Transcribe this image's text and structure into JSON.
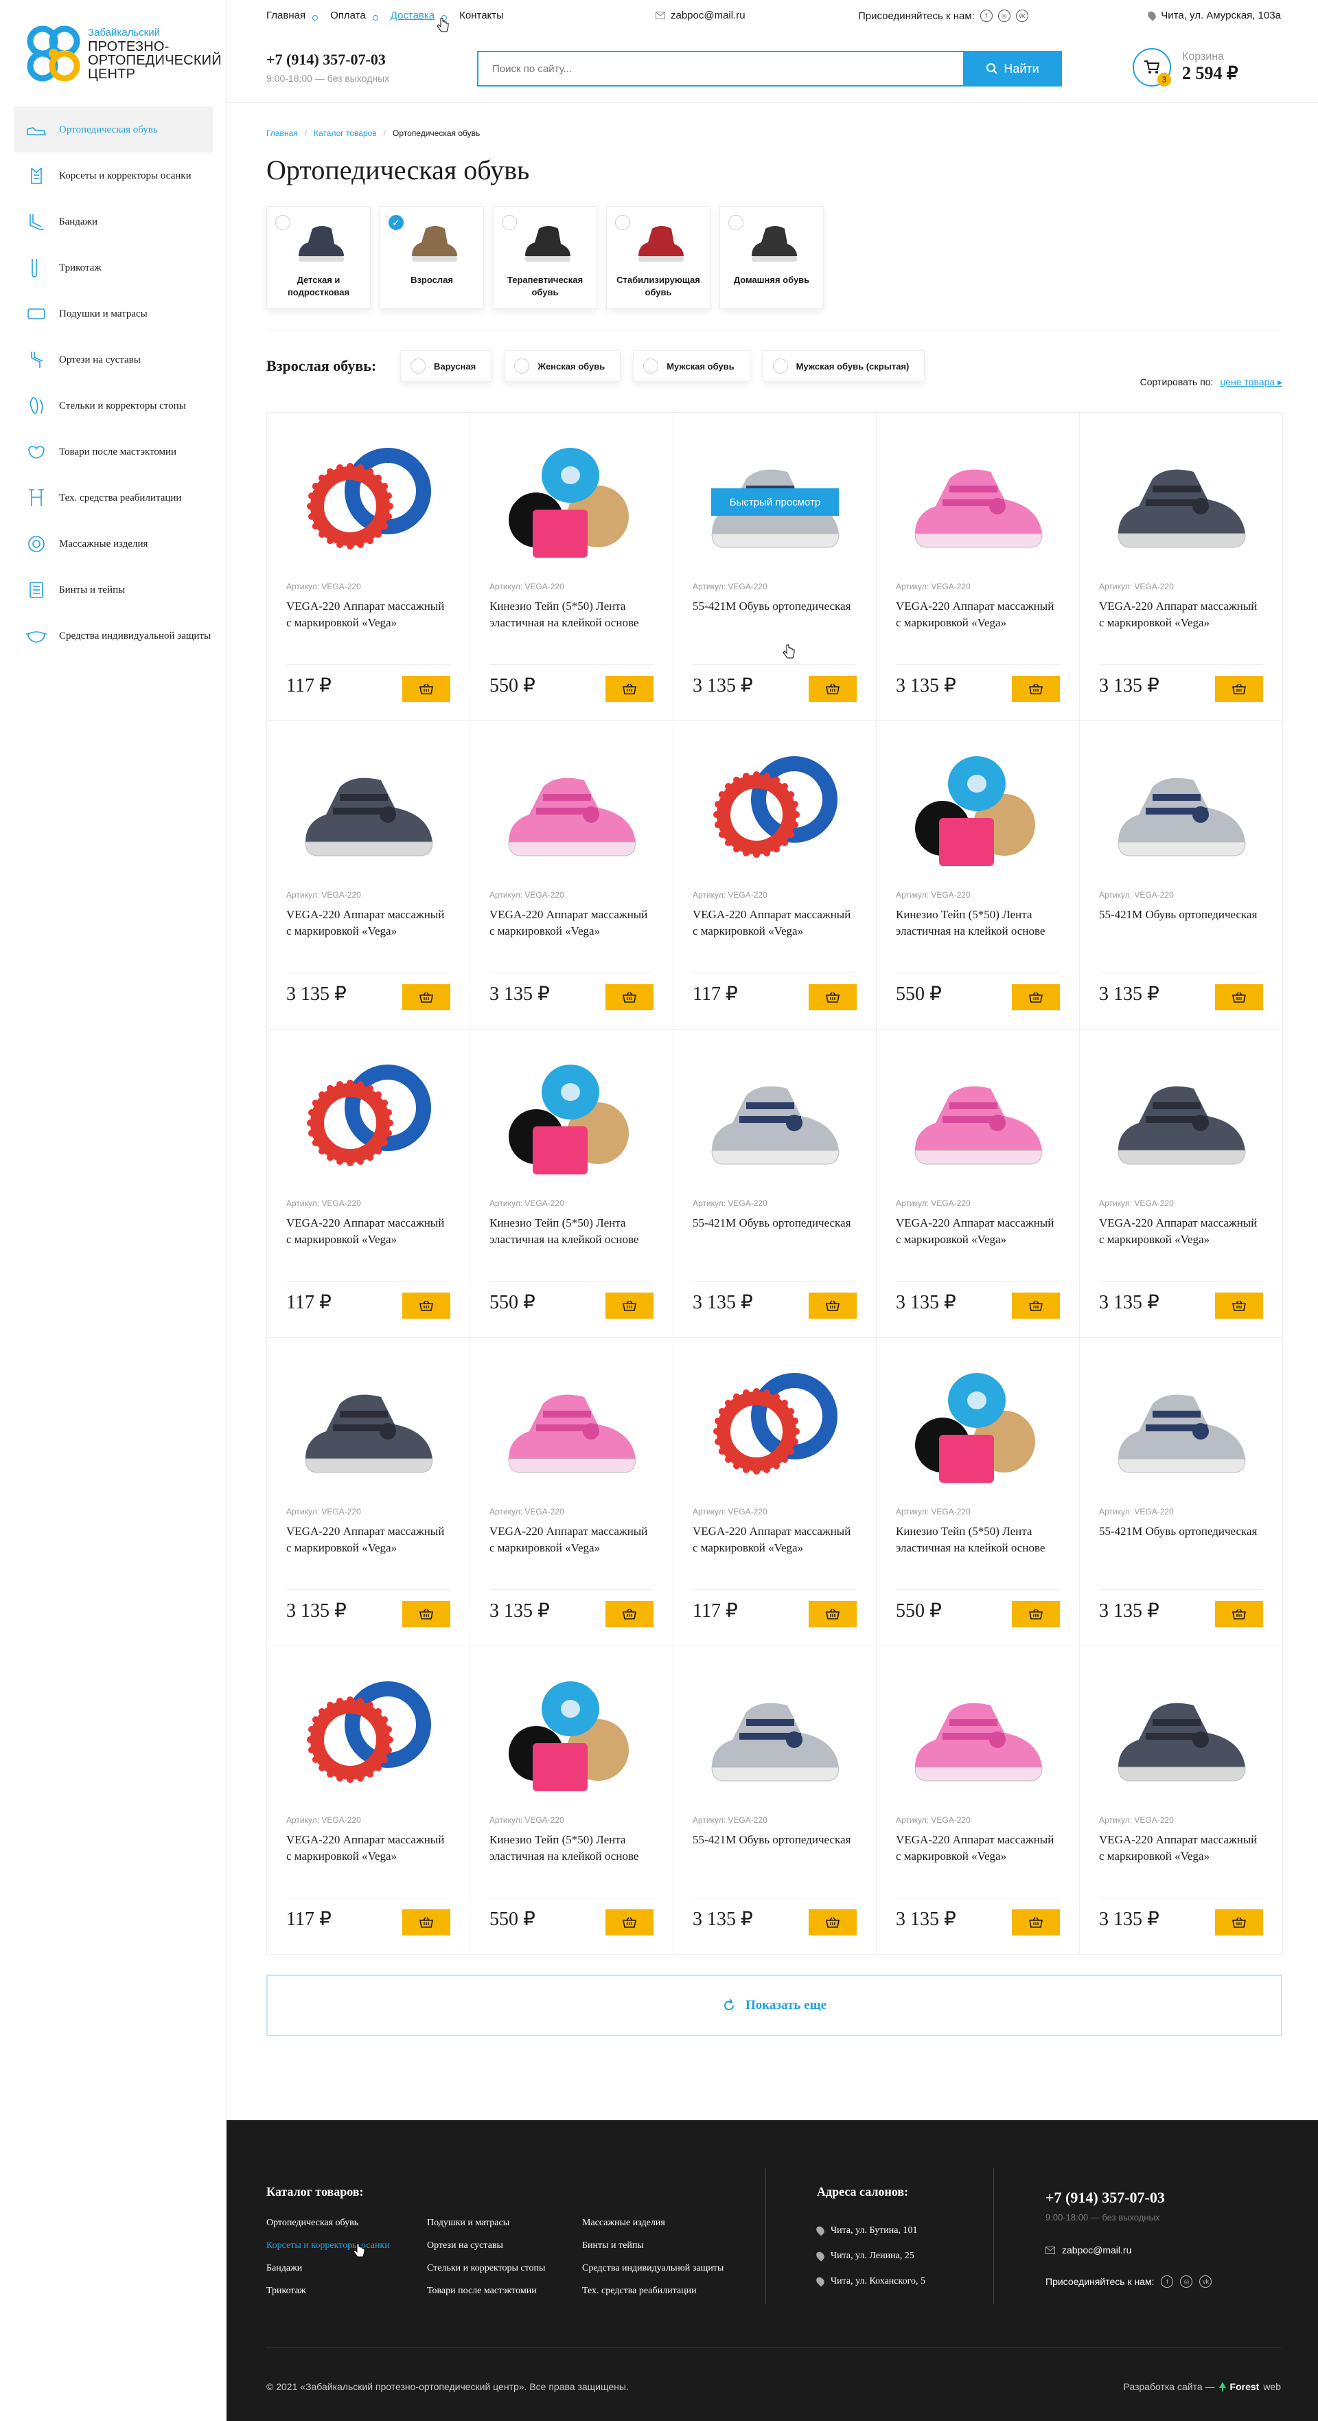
{
  "logo": {
    "line1": "Забайкальский",
    "line2": "ПРОТЕЗНО-",
    "line3": "ОРТОПЕДИЧЕСКИЙ",
    "line4": "ЦЕНТР"
  },
  "sidebar": {
    "items": [
      {
        "label": "Ортопедическая обувь",
        "icon": "shoe-icon",
        "active": true
      },
      {
        "label": "Корсеты и корректоры осанки",
        "icon": "corset-icon"
      },
      {
        "label": "Бандажи",
        "icon": "bandage-icon"
      },
      {
        "label": "Трикотаж",
        "icon": "stocking-icon"
      },
      {
        "label": "Подушки и матрасы",
        "icon": "pillow-icon"
      },
      {
        "label": "Ортези на суставы",
        "icon": "joint-icon"
      },
      {
        "label": "Стельки и корректоры стопы",
        "icon": "insole-icon"
      },
      {
        "label": "Товари после мастэктомии",
        "icon": "mastectomy-icon"
      },
      {
        "label": "Тех. средства реабилитации",
        "icon": "crutch-icon"
      },
      {
        "label": "Массажные изделия",
        "icon": "massage-icon"
      },
      {
        "label": "Бинты и тейпы",
        "icon": "tape-icon"
      },
      {
        "label": "Средства индивидуальной защиты",
        "icon": "mask-icon"
      }
    ]
  },
  "topbar": {
    "nav": [
      "Главная",
      "Оплата",
      "Доставка",
      "Контакты"
    ],
    "email": "zabpoc@mail.ru",
    "join_label": "Присоединяйтесь к нам:",
    "address": "Чита, ул. Амурская, 103а"
  },
  "header": {
    "phone": "+7 (914) 357-07-03",
    "hours": "9:00-18:00 — без выходных",
    "search_placeholder": "Поиск по сайту...",
    "search_button": "Найти",
    "cart_label": "Корзина",
    "cart_total": "2 594 ₽",
    "cart_count": "3"
  },
  "breadcrumbs": [
    "Главная",
    "Каталог товаров",
    "Ортопедическая обувь"
  ],
  "page_title": "Ортопедическая обувь",
  "categories": [
    {
      "name": "Детская и подростковая",
      "checked": false
    },
    {
      "name": "Взрослая",
      "checked": true
    },
    {
      "name": "Терапевтическая обувь",
      "checked": false
    },
    {
      "name": "Стабилизирующая обувь",
      "checked": false
    },
    {
      "name": "Домашняя обувь",
      "checked": false
    }
  ],
  "filter": {
    "label": "Взрослая обувь:",
    "options": [
      "Варусная",
      "Женская обувь",
      "Мужская обувь",
      "Мужская обувь (скрытая)"
    ]
  },
  "sort": {
    "label": "Сортировать по:",
    "value": "цене товара"
  },
  "quick_view": "Быстрый просмотр",
  "products": [
    {
      "img": "ring",
      "sku": "Артикул: VEGA-220",
      "title": "VEGA-220 Аппарат массажный с маркировкой «Vega»",
      "price": "117 ₽"
    },
    {
      "img": "tape",
      "sku": "Артикул: VEGA-220",
      "title": "Кинезио Тейп (5*50) Лента эластичная на клейкой основе",
      "price": "550 ₽"
    },
    {
      "img": "grey",
      "sku": "Артикул: VEGA-220",
      "title": "55-421M Обувь ортопедическая",
      "price": "3 135 ₽"
    },
    {
      "img": "pink",
      "sku": "Артикул: VEGA-220",
      "title": "VEGA-220 Аппарат массажный с маркировкой «Vega»",
      "price": "3 135 ₽"
    },
    {
      "img": "dark",
      "sku": "Артикул: VEGA-220",
      "title": "VEGA-220 Аппарат массажный с маркировкой «Vega»",
      "price": "3 135 ₽"
    },
    {
      "img": "dark",
      "sku": "Артикул: VEGA-220",
      "title": "VEGA-220 Аппарат массажный с маркировкой «Vega»",
      "price": "3 135 ₽"
    },
    {
      "img": "pink",
      "sku": "Артикул: VEGA-220",
      "title": "VEGA-220 Аппарат массажный с маркировкой «Vega»",
      "price": "3 135 ₽"
    },
    {
      "img": "ring",
      "sku": "Артикул: VEGA-220",
      "title": "VEGA-220 Аппарат массажный с маркировкой «Vega»",
      "price": "117 ₽"
    },
    {
      "img": "tape",
      "sku": "Артикул: VEGA-220",
      "title": "Кинезио Тейп (5*50) Лента эластичная на клейкой основе",
      "price": "550 ₽"
    },
    {
      "img": "grey",
      "sku": "Артикул: VEGA-220",
      "title": "55-421M Обувь ортопедическая",
      "price": "3 135 ₽"
    },
    {
      "img": "ring",
      "sku": "Артикул: VEGA-220",
      "title": "VEGA-220 Аппарат массажный с маркировкой «Vega»",
      "price": "117 ₽"
    },
    {
      "img": "tape",
      "sku": "Артикул: VEGA-220",
      "title": "Кинезио Тейп (5*50) Лента эластичная на клейкой основе",
      "price": "550 ₽"
    },
    {
      "img": "grey",
      "sku": "Артикул: VEGA-220",
      "title": "55-421M Обувь ортопедическая",
      "price": "3 135 ₽"
    },
    {
      "img": "pink",
      "sku": "Артикул: VEGA-220",
      "title": "VEGA-220 Аппарат массажный с маркировкой «Vega»",
      "price": "3 135 ₽"
    },
    {
      "img": "dark",
      "sku": "Артикул: VEGA-220",
      "title": "VEGA-220 Аппарат массажный с маркировкой «Vega»",
      "price": "3 135 ₽"
    },
    {
      "img": "dark",
      "sku": "Артикул: VEGA-220",
      "title": "VEGA-220 Аппарат массажный с маркировкой «Vega»",
      "price": "3 135 ₽"
    },
    {
      "img": "pink",
      "sku": "Артикул: VEGA-220",
      "title": "VEGA-220 Аппарат массажный с маркировкой «Vega»",
      "price": "3 135 ₽"
    },
    {
      "img": "ring",
      "sku": "Артикул: VEGA-220",
      "title": "VEGA-220 Аппарат массажный с маркировкой «Vega»",
      "price": "117 ₽"
    },
    {
      "img": "tape",
      "sku": "Артикул: VEGA-220",
      "title": "Кинезио Тейп (5*50) Лента эластичная на клейкой основе",
      "price": "550 ₽"
    },
    {
      "img": "grey",
      "sku": "Артикул: VEGA-220",
      "title": "55-421M Обувь ортопедическая",
      "price": "3 135 ₽"
    },
    {
      "img": "ring",
      "sku": "Артикул: VEGA-220",
      "title": "VEGA-220 Аппарат массажный с маркировкой «Vega»",
      "price": "117 ₽"
    },
    {
      "img": "tape",
      "sku": "Артикул: VEGA-220",
      "title": "Кинезио Тейп (5*50) Лента эластичная на клейкой основе",
      "price": "550 ₽"
    },
    {
      "img": "grey",
      "sku": "Артикул: VEGA-220",
      "title": "55-421M Обувь ортопедическая",
      "price": "3 135 ₽"
    },
    {
      "img": "pink",
      "sku": "Артикул: VEGA-220",
      "title": "VEGA-220 Аппарат массажный с маркировкой «Vega»",
      "price": "3 135 ₽"
    },
    {
      "img": "dark",
      "sku": "Артикул: VEGA-220",
      "title": "VEGA-220 Аппарат массажный с маркировкой «Vega»",
      "price": "3 135 ₽"
    }
  ],
  "show_more": "Показать еще",
  "footer": {
    "catalog_title": "Каталог товаров:",
    "col1": [
      "Ортопедическая обувь",
      "Корсеты и корректоры осанки",
      "Бандажи",
      "Трикотаж"
    ],
    "col2": [
      "Подушки и матрасы",
      "Ортези на суставы",
      "Стельки и корректоры стопы",
      "Товари после мастэктомии"
    ],
    "col3": [
      "Массажные изделия",
      "Бинты и тейпы",
      "Средства индивидуальной  защиты",
      "Тех. средства реабилитации"
    ],
    "addr_title": "Адреса салонов:",
    "addresses": [
      "Чита, ул. Бутина, 101",
      "Чита, ул. Ленина, 25",
      "Чита, ул. Коханского, 5"
    ],
    "phone": "+7 (914) 357-07-03",
    "hours": "9:00-18:00 — без выходных",
    "email": "zabpoc@mail.ru",
    "join": "Присоединяйтесь к нам:",
    "copyright": "© 2021 «Забайкальский протезно-ортопедический центр». Все права защищены.",
    "dev_label": "Разработка сайта —",
    "dev_name": "Forest",
    "dev_suffix": "web"
  },
  "colors": {
    "accent": "#21a1e1",
    "buy": "#f7b500",
    "footer_bg": "#1b1b1b"
  }
}
